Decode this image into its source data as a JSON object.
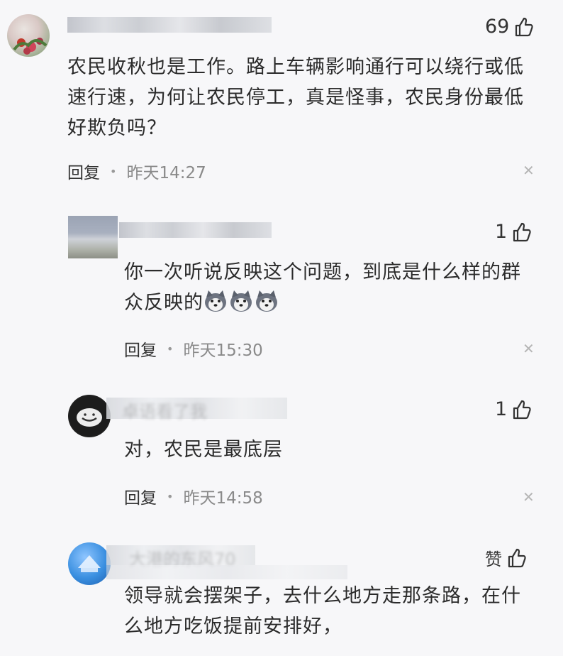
{
  "comments": [
    {
      "text": "农民收秋也是工作。路上车辆影响通行可以绕行或低速行速，为何让农民停工，真是怪事，农民身份最低好欺负吗？",
      "likes": "69",
      "reply_label": "回复",
      "time": "昨天14:27"
    },
    {
      "text": "你一次听说反映这个问题，到底是什么样的群众反映的",
      "likes": "1",
      "reply_label": "回复",
      "time": "昨天15:30"
    },
    {
      "username": "卓语看了我",
      "text": "对，农民是最底层",
      "likes": "1",
      "reply_label": "回复",
      "time": "昨天14:58"
    },
    {
      "username": "大港的东风70",
      "text": "领导就会摆架子，去什么地方走那条路，在什么地方吃饭提前安排好，",
      "likes": "赞"
    }
  ],
  "icons": {
    "like": "thumbs-up-icon",
    "close": "close-icon",
    "emoji": "husky-dog-emoji"
  },
  "colors": {
    "background": "#f7f7f9",
    "text": "#2b2b2b",
    "meta": "#8a8a8a"
  }
}
